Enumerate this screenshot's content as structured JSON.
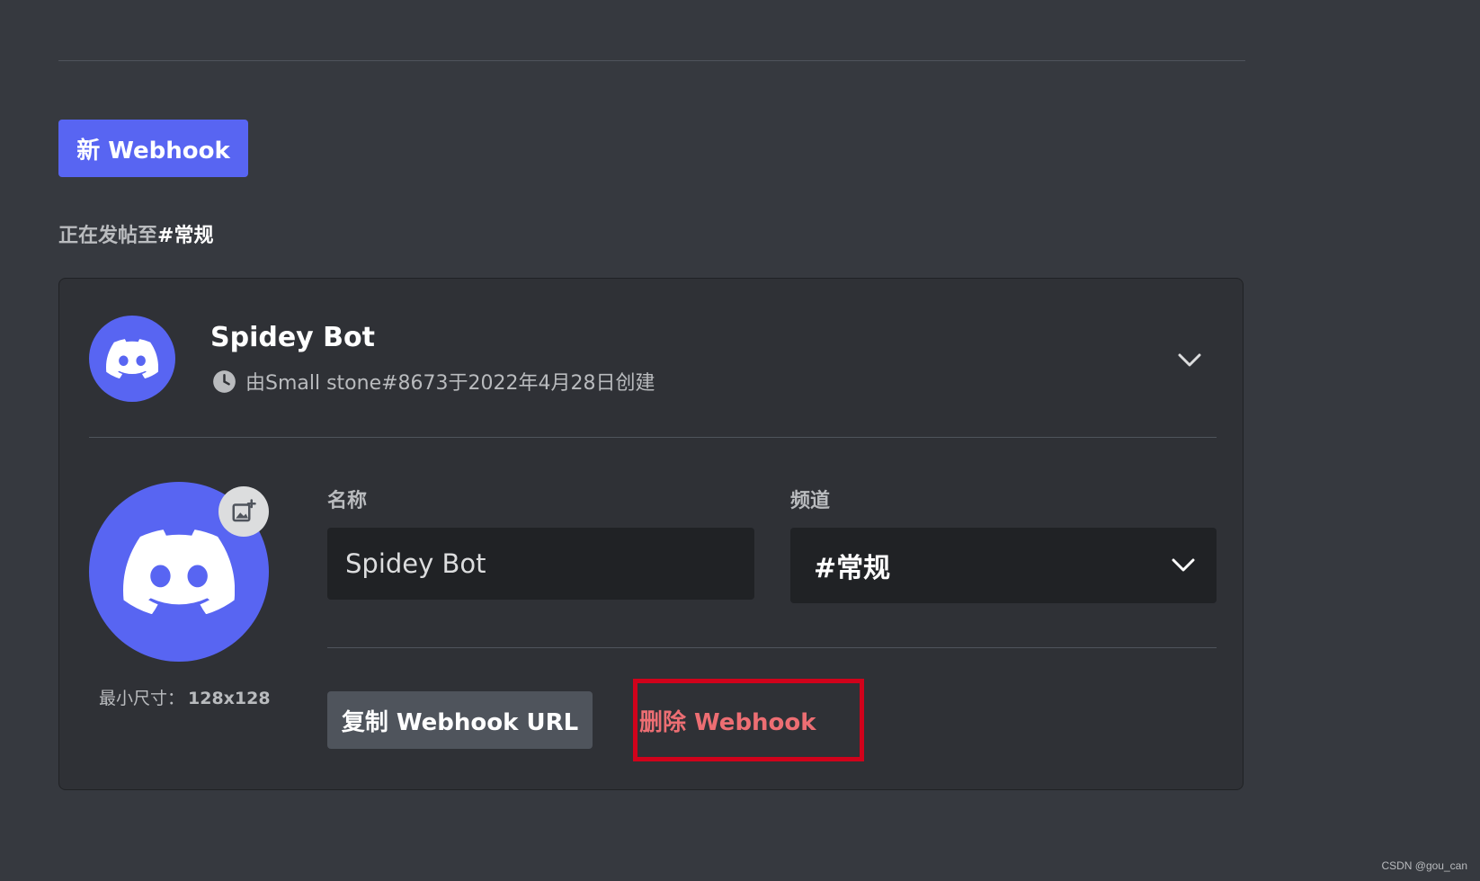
{
  "header": {
    "new_webhook_label": "新 Webhook",
    "posting_to_prefix": "正在发帖至",
    "posting_to_channel": "#常规"
  },
  "webhook": {
    "name": "Spidey Bot",
    "created_info": "由Small stone#8673于2022年4月28日创建",
    "avatar_icon": "discord-logo-icon",
    "min_size_label": "最小尺寸：",
    "min_size_value": "128x128",
    "name_label": "名称",
    "name_value": "Spidey Bot",
    "channel_label": "频道",
    "channel_value": "#常规",
    "copy_url_label": "复制 Webhook URL",
    "delete_label": "删除 Webhook"
  },
  "colors": {
    "background": "#36393f",
    "card": "#2f3136",
    "brand": "#5865f2",
    "danger_text": "#ed6e73",
    "highlight_box": "#d0021b"
  },
  "watermark": "CSDN @gou_can"
}
